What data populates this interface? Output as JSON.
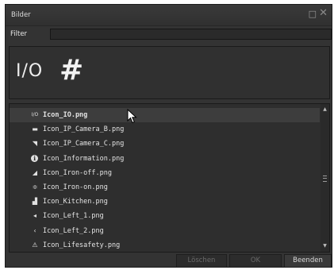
{
  "window": {
    "title": "Bilder",
    "maximize_glyph": "□",
    "close_glyph": "✕"
  },
  "filter": {
    "label": "Filter",
    "value": ""
  },
  "preview": {
    "io_text": "I/O",
    "hash_glyph": "#"
  },
  "list": {
    "selected_index": 0,
    "items": [
      {
        "label": "Icon_IO.png",
        "icon": "io-icon",
        "glyph": "I/O"
      },
      {
        "label": "Icon_IP_Camera_B.png",
        "icon": "camera-icon",
        "glyph": "▬"
      },
      {
        "label": "Icon_IP_Camera_C.png",
        "icon": "camera-wall-icon",
        "glyph": "◥"
      },
      {
        "label": "Icon_Information.png",
        "icon": "info-icon",
        "glyph": "ℹ"
      },
      {
        "label": "Icon_Iron-off.png",
        "icon": "iron-icon",
        "glyph": "◢"
      },
      {
        "label": "Icon_Iron-on.png",
        "icon": "iron-on-icon",
        "glyph": "≑"
      },
      {
        "label": "Icon_Kitchen.png",
        "icon": "kitchen-icon",
        "glyph": "▟"
      },
      {
        "label": "Icon_Left_1.png",
        "icon": "arrow-left-icon",
        "glyph": "◂"
      },
      {
        "label": "Icon_Left_2.png",
        "icon": "chevron-left-icon",
        "glyph": "‹"
      },
      {
        "label": "Icon_Lifesafety.png",
        "icon": "warning-icon",
        "glyph": "⚠"
      }
    ]
  },
  "buttons": {
    "delete": "Löschen",
    "ok": "OK",
    "quit": "Beenden"
  }
}
